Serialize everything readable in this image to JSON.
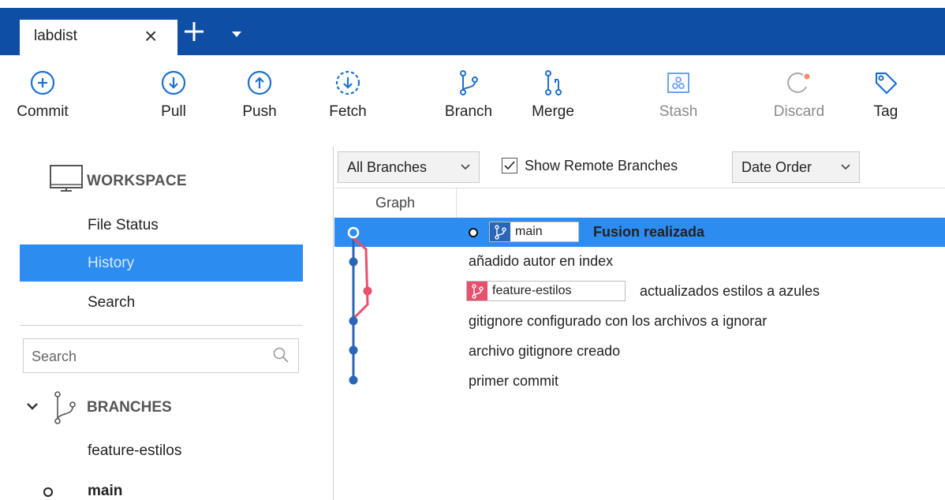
{
  "tab": {
    "title": "labdist",
    "close": "×"
  },
  "toolbar": {
    "commit": "Commit",
    "pull": "Pull",
    "push": "Push",
    "fetch": "Fetch",
    "branch": "Branch",
    "merge": "Merge",
    "stash": "Stash",
    "discard": "Discard",
    "tag": "Tag"
  },
  "sidebar": {
    "workspace_title": "WORKSPACE",
    "items": [
      {
        "label": "File Status",
        "active": false
      },
      {
        "label": "History",
        "active": true
      },
      {
        "label": "Search",
        "active": false
      }
    ],
    "search_placeholder": "Search",
    "branches_title": "BRANCHES",
    "branches": [
      {
        "name": "feature-estilos",
        "current": false
      },
      {
        "name": "main",
        "current": true
      }
    ]
  },
  "filters": {
    "branches_dropdown": "All Branches",
    "show_remote_label": "Show Remote Branches",
    "show_remote_checked": true,
    "order_dropdown": "Date Order"
  },
  "columns": {
    "graph": "Graph"
  },
  "commits": [
    {
      "message": "Fusion realizada",
      "branch_tag": "main",
      "is_head": true,
      "selected": true
    },
    {
      "message": "añadido autor en index"
    },
    {
      "message": "actualizados estilos a azules",
      "branch_tag": "feature-estilos"
    },
    {
      "message": "gitignore configurado con los archivos a ignorar"
    },
    {
      "message": "archivo gitignore creado"
    },
    {
      "message": "primer commit"
    }
  ],
  "colors": {
    "titlebar": "#0f4ea5",
    "accent": "#2d8cf0",
    "main_lane": "#2966b8",
    "feature_lane": "#e8506d"
  }
}
